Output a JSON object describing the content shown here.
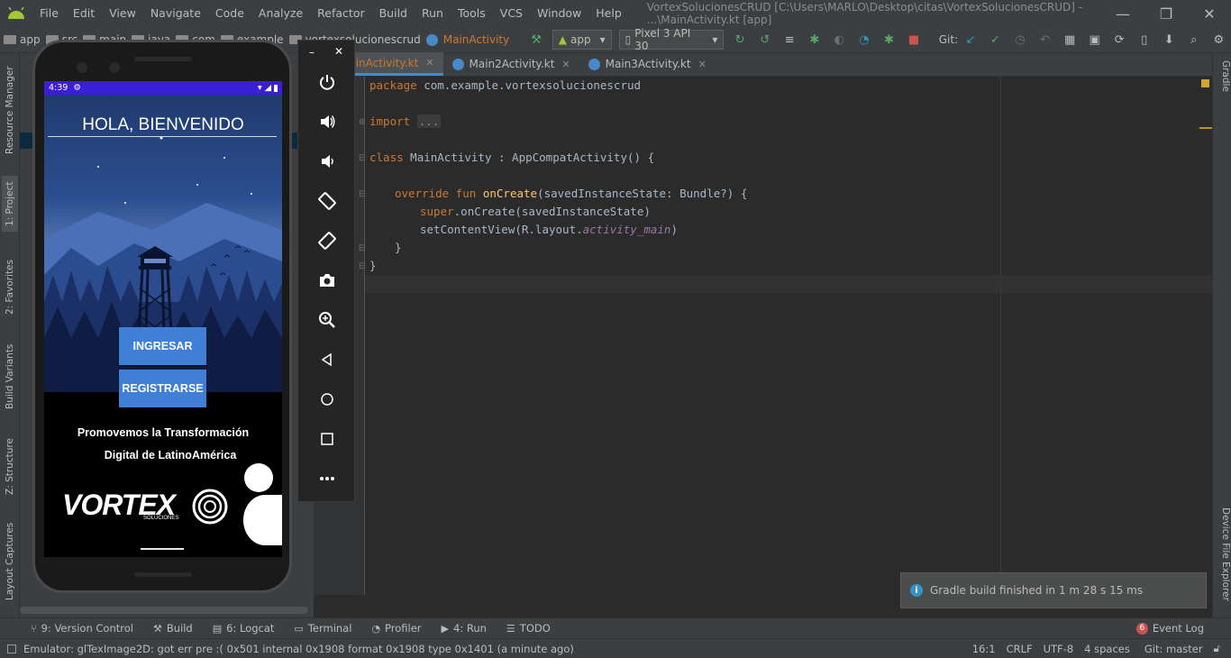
{
  "window": {
    "title": "VortexSolucionesCRUD [C:\\Users\\MARLO\\Desktop\\citas\\VortexSolucionesCRUD] - ...\\MainActivity.kt [app]",
    "minimize": "—",
    "restore": "❐",
    "close": "✕"
  },
  "menu": [
    "File",
    "Edit",
    "View",
    "Navigate",
    "Code",
    "Analyze",
    "Refactor",
    "Build",
    "Run",
    "Tools",
    "VCS",
    "Window",
    "Help"
  ],
  "toolbar": {
    "breadcrumb": [
      "app",
      "src",
      "main",
      "java",
      "com",
      "example",
      "vortexsolucionescrud",
      "MainActivity"
    ],
    "run_config": "app",
    "device": "Pixel 3 API 30",
    "git_label": "Git:"
  },
  "left_tools": [
    "Resource Manager",
    "1: Project",
    "2: Favorites",
    "Build Variants",
    "Z: Structure",
    "Layout Captures"
  ],
  "right_tools": [
    "Gradle",
    "Device File Explorer"
  ],
  "tabs": [
    {
      "label": "MainActivity.kt",
      "active": true
    },
    {
      "label": "Main2Activity.kt",
      "active": false
    },
    {
      "label": "Main3Activity.kt",
      "active": false
    }
  ],
  "code": {
    "l1_kw": "package",
    "l1_rest": " com.example.vortexsolucionescrud",
    "l3_kw": "import",
    "l3_fold": "...",
    "l5_kw": "class",
    "l5_rest": " MainActivity : AppCompatActivity() {",
    "l7_kw": "override fun",
    "l7_fn": "onCreate",
    "l7_rest": "(savedInstanceState: Bundle?) {",
    "l8_kw": "super",
    "l8_rest": ".onCreate(savedInstanceState)",
    "l9_a": "setContentView(R.layout.",
    "l9_it": "activity_main",
    "l9_b": ")",
    "l10": "}",
    "l11": "}"
  },
  "notification": "Gradle build finished in 1 m 28 s 15 ms",
  "bottom_tools": [
    "9: Version Control",
    "Build",
    "6: Logcat",
    "Terminal",
    "Profiler",
    "4: Run",
    "TODO"
  ],
  "event_log": {
    "count": "6",
    "label": "Event Log"
  },
  "status": {
    "message": "Emulator: glTexImage2D: got err pre :( 0x501 internal 0x1908 format 0x1908 type 0x1401 (a minute ago)",
    "position": "16:1",
    "line_sep": "CRLF",
    "encoding": "UTF-8",
    "indent": "4 spaces",
    "git": "Git: master"
  },
  "phone": {
    "time": "4:39",
    "welcome": "HOLA, BIENVENIDO",
    "btn_login": "INGRESAR",
    "btn_register": "REGISTRARSE",
    "slogan_line1": "Promovemos la Transformación",
    "slogan_line2": "Digital de LatinoAmérica",
    "brand": "VORTEX",
    "brand_sub": "SOLUCIONES"
  },
  "colors": {
    "ide_bg": "#2b2b2b",
    "panel_bg": "#3c3f41",
    "keyword": "#cc7832",
    "function": "#ffc66d",
    "phone_button": "#3f7fd6",
    "phone_statusbar": "#3b1fd6"
  }
}
